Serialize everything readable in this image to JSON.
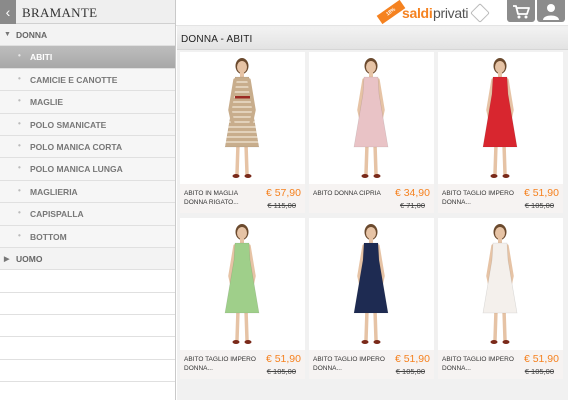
{
  "sidebar": {
    "brand": "BRAMANTE",
    "items": [
      {
        "label": "DONNA",
        "type": "category",
        "arrow": "down"
      },
      {
        "label": "ABITI",
        "type": "sub",
        "active": true
      },
      {
        "label": "CAMICIE E CANOTTE",
        "type": "sub"
      },
      {
        "label": "MAGLIE",
        "type": "sub"
      },
      {
        "label": "POLO SMANICATE",
        "type": "sub"
      },
      {
        "label": "POLO MANICA CORTA",
        "type": "sub"
      },
      {
        "label": "POLO MANICA LUNGA",
        "type": "sub"
      },
      {
        "label": "MAGLIERIA",
        "type": "sub"
      },
      {
        "label": "CAPISPALLA",
        "type": "sub"
      },
      {
        "label": "BOTTOM",
        "type": "sub"
      },
      {
        "label": "UOMO",
        "type": "category",
        "arrow": "right"
      }
    ]
  },
  "header": {
    "logo_ribbon": "18%",
    "logo_word_1": "saldi",
    "logo_word_2": "privati"
  },
  "main": {
    "title": "DONNA - ABITI",
    "products": [
      {
        "name": "ABITO IN MAGLIA DONNA RIGATO...",
        "price": "€ 57,90",
        "old_price": "€ 115,00",
        "dress_color": "#c8ad8c",
        "stripes": true
      },
      {
        "name": "ABITO DONNA CIPRIA",
        "price": "€ 34,90",
        "old_price": "€ 71,00",
        "dress_color": "#e9c3c6",
        "stripes": false
      },
      {
        "name": "ABITO TAGLIO IMPERO DONNA...",
        "price": "€ 51,90",
        "old_price": "€ 105,00",
        "dress_color": "#d8262f",
        "stripes": false
      },
      {
        "name": "ABITO TAGLIO IMPERO DONNA...",
        "price": "€ 51,90",
        "old_price": "€ 105,00",
        "dress_color": "#9fcf8a",
        "stripes": false
      },
      {
        "name": "ABITO TAGLIO IMPERO DONNA...",
        "price": "€ 51,90",
        "old_price": "€ 105,00",
        "dress_color": "#1e2b52",
        "stripes": false
      },
      {
        "name": "ABITO TAGLIO IMPERO DONNA...",
        "price": "€ 51,90",
        "old_price": "€ 105,00",
        "dress_color": "#f4f0ec",
        "stripes": false
      }
    ]
  },
  "colors": {
    "accent": "#f58220",
    "active_row": "#b0b0b0",
    "icon_button": "#8c8c8c"
  }
}
